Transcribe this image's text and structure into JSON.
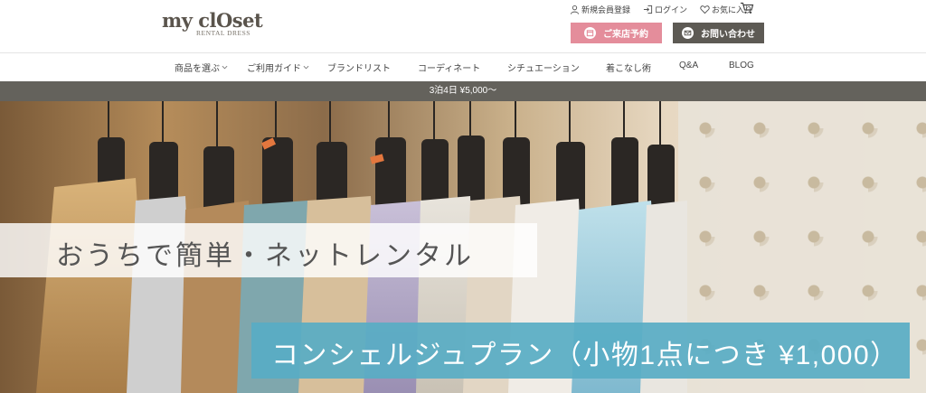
{
  "brand": {
    "logo_main": "my clOset",
    "logo_sub": "RENTAL DRESS"
  },
  "utility_links": {
    "register": "新規会員登録",
    "login": "ログイン",
    "favorites": "お気に入り"
  },
  "buttons": {
    "visit": "ご来店予約",
    "contact": "お問い合わせ"
  },
  "nav": {
    "items": [
      {
        "label": "商品を選ぶ",
        "dropdown": true
      },
      {
        "label": "ご利用ガイド",
        "dropdown": true
      },
      {
        "label": "ブランドリスト",
        "dropdown": false
      },
      {
        "label": "コーディネート",
        "dropdown": false
      },
      {
        "label": "シチュエーション",
        "dropdown": false
      },
      {
        "label": "着こなし術",
        "dropdown": false
      },
      {
        "label": "Q&A",
        "dropdown": false
      },
      {
        "label": "BLOG",
        "dropdown": false
      }
    ]
  },
  "promo_bar": {
    "text": "3泊4日 ¥5,000〜"
  },
  "hero": {
    "headline": "おうちで簡単・ネットレンタル",
    "subline": "コンシェルジュプラン（小物1点につき ¥1,000）"
  },
  "colors": {
    "visit_button": "#e48d9b",
    "contact_button": "#5d5a54",
    "promo_bar": "#64625c",
    "hero_blue": "#58acc4"
  },
  "icons": {
    "register": "user-icon",
    "login": "login-icon",
    "favorites": "heart-icon",
    "cart": "cart-icon",
    "visit": "calendar-icon",
    "contact": "mail-icon"
  }
}
